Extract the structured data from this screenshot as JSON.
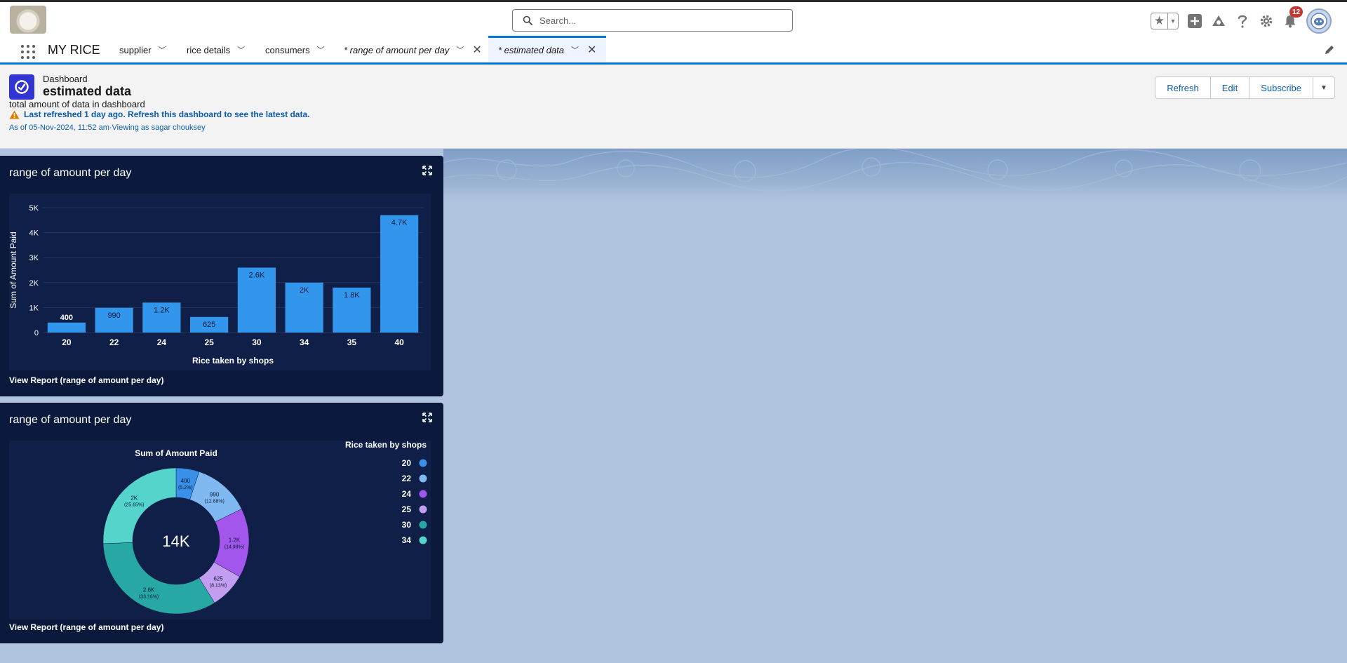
{
  "header": {
    "search_placeholder": "Search...",
    "notification_count": "12"
  },
  "nav": {
    "app_name": "MY RICE",
    "items": [
      {
        "label": "supplier"
      },
      {
        "label": "rice details"
      },
      {
        "label": "consumers"
      },
      {
        "label": "* range of amount per day"
      },
      {
        "label": "* estimated data"
      }
    ]
  },
  "dashboard": {
    "type_label": "Dashboard",
    "title": "estimated data",
    "description": "total amount of data in dashboard",
    "warning": "Last refreshed 1 day ago. Refresh this dashboard to see the latest data.",
    "as_of": "As of 05-Nov-2024, 11:52 am·Viewing as sagar chouksey",
    "buttons": {
      "refresh": "Refresh",
      "edit": "Edit",
      "subscribe": "Subscribe"
    }
  },
  "widgets": {
    "bar": {
      "title": "range of amount per day",
      "link": "View Report (range of amount per day)"
    },
    "donut": {
      "title": "range of amount per day",
      "link": "View Report (range of amount per day)"
    }
  },
  "chart_data": [
    {
      "type": "bar",
      "xlabel": "Rice taken by shops",
      "ylabel": "Sum of Amount Paid",
      "categories": [
        "20",
        "22",
        "24",
        "25",
        "30",
        "34",
        "35",
        "40"
      ],
      "values": [
        400,
        990,
        1200,
        625,
        2600,
        2000,
        1800,
        4700
      ],
      "data_labels": [
        "400",
        "990",
        "1.2K",
        "625",
        "2.6K",
        "2K",
        "1.8K",
        "4.7K"
      ],
      "yticks": [
        0,
        1000,
        2000,
        3000,
        4000,
        5000
      ],
      "ytick_labels": [
        "0",
        "1K",
        "2K",
        "3K",
        "4K",
        "5K"
      ],
      "ylim": [
        0,
        5000
      ],
      "grid": true,
      "colors": {
        "bar": "#3296ed"
      }
    },
    {
      "type": "pie",
      "title": "Sum of Amount Paid",
      "center_label": "14K",
      "legend_title": "Rice taken by shops",
      "legend_placement": "right",
      "slices": [
        {
          "name": "20",
          "value": 400,
          "label": "400",
          "pct": "(5.2%)",
          "color": "#3a8fe8"
        },
        {
          "name": "22",
          "value": 990,
          "label": "990",
          "pct": "(12.88%)",
          "color": "#80b9f2"
        },
        {
          "name": "24",
          "value": 1200,
          "label": "1.2K",
          "pct": "(14.98%)",
          "color": "#a356ec"
        },
        {
          "name": "25",
          "value": 625,
          "label": "625",
          "pct": "(8.13%)",
          "color": "#c39ef0"
        },
        {
          "name": "30",
          "value": 2600,
          "label": "2.6K",
          "pct": "(33.16%)",
          "color": "#27a8a4"
        },
        {
          "name": "34",
          "value": 2000,
          "label": "2K",
          "pct": "(25.65%)",
          "color": "#55d4cc"
        }
      ]
    }
  ]
}
